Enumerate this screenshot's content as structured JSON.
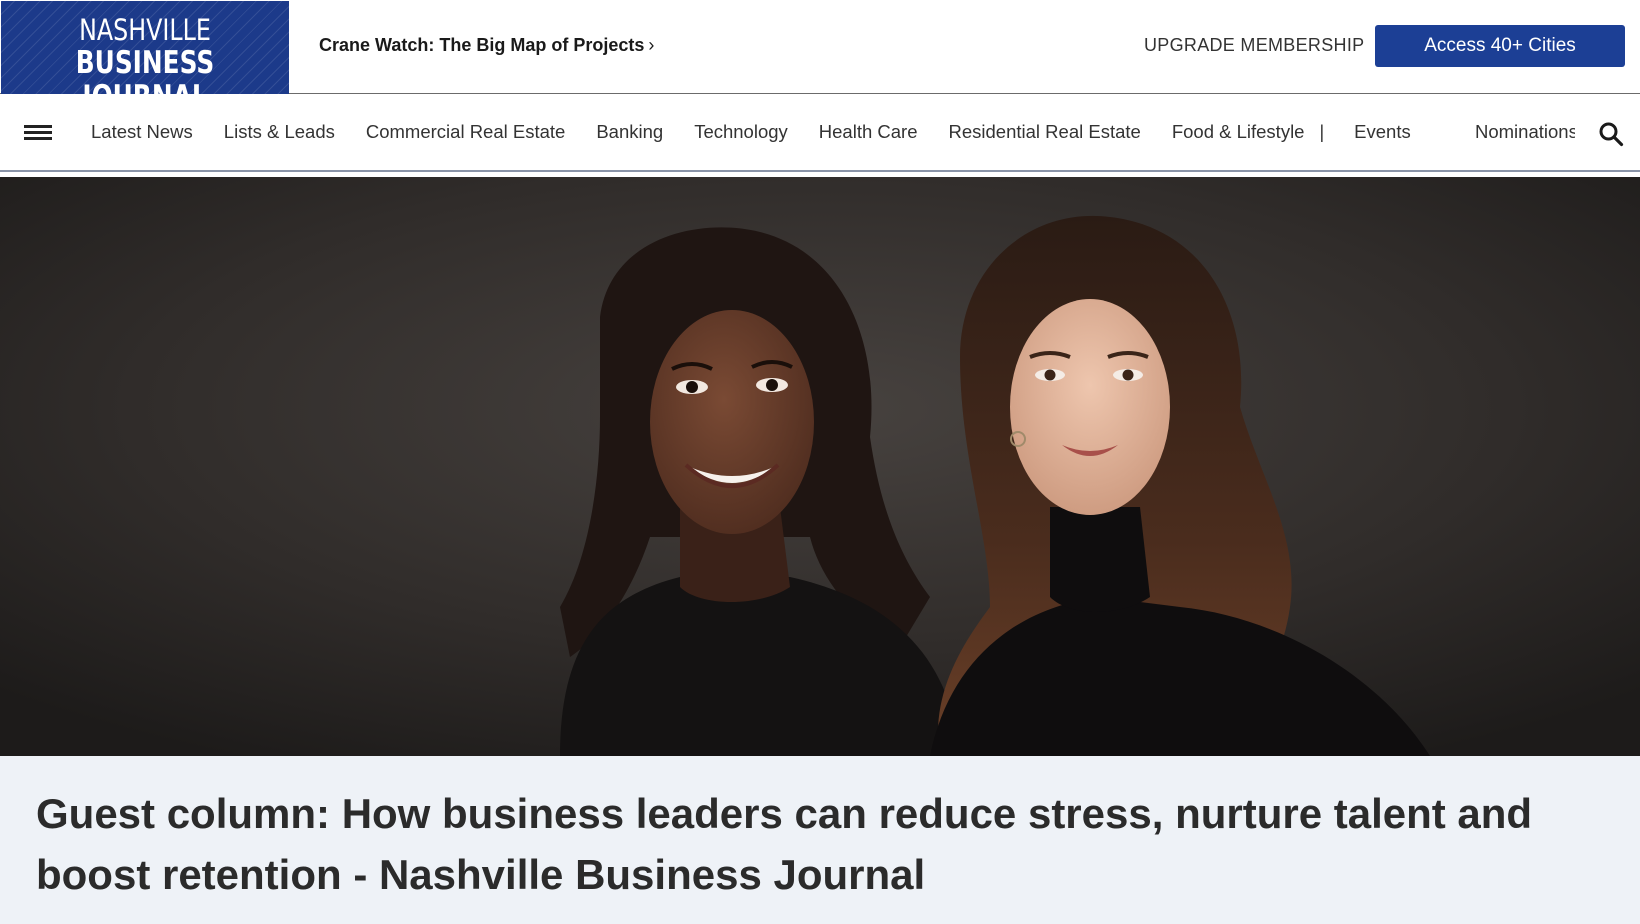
{
  "header": {
    "logo_line1": "NASHVILLE",
    "logo_line2": "BUSINESS JOURNAL",
    "promo_text": "Crane Watch: The Big Map of Projects",
    "upgrade_label": "UPGRADE MEMBERSHIP",
    "access_label": "Access 40+ Cities",
    "accent_color": "#1c3f95"
  },
  "nav": {
    "items": [
      "Latest News",
      "Lists & Leads",
      "Commercial Real Estate",
      "Banking",
      "Technology",
      "Health Care",
      "Residential Real Estate",
      "Food & Lifestyle"
    ],
    "separator": "|",
    "events_label": "Events",
    "truncated_item": "Nominations",
    "search_icon": "search-icon",
    "menu_icon": "hamburger-icon"
  },
  "article": {
    "headline": "Guest column: How business leaders can reduce stress, nurture talent and boost retention - Nashville Business Journal"
  }
}
